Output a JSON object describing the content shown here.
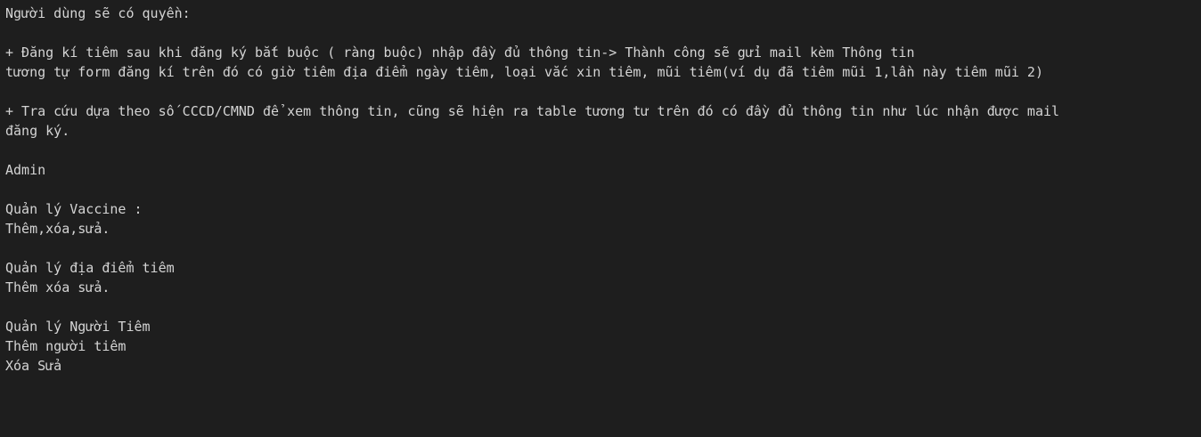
{
  "document": {
    "lines": [
      "Người dùng sẽ có quyền:",
      "",
      "+ Đăng kí tiêm sau khi đăng ký bắt buộc ( ràng buộc) nhập đầy đủ thông tin-> Thành công sẽ gửi mail kèm Thông tin",
      "tương tự form đăng kí trên đó có giờ tiêm địa điểm ngày tiêm, loại vắc xin tiêm, mũi tiêm(ví dụ đã tiêm mũi 1,lần này tiêm mũi 2)",
      "",
      "+ Tra cứu dựa theo số CCCD/CMND để xem thông tin, cũng sẽ hiện ra table tương tư trên đó có đầy đủ thông tin như lúc nhận được mail",
      "đăng ký.",
      "",
      "Admin",
      "",
      "Quản lý Vaccine :",
      "Thêm,xóa,sửa.",
      "",
      "Quản lý địa điểm tiêm",
      "Thêm xóa sửa.",
      "",
      "Quản lý Người Tiêm",
      "Thêm người tiêm",
      "Xóa Sửa"
    ]
  },
  "colors": {
    "background": "#1e1e1e",
    "text": "#d4d4d4"
  }
}
